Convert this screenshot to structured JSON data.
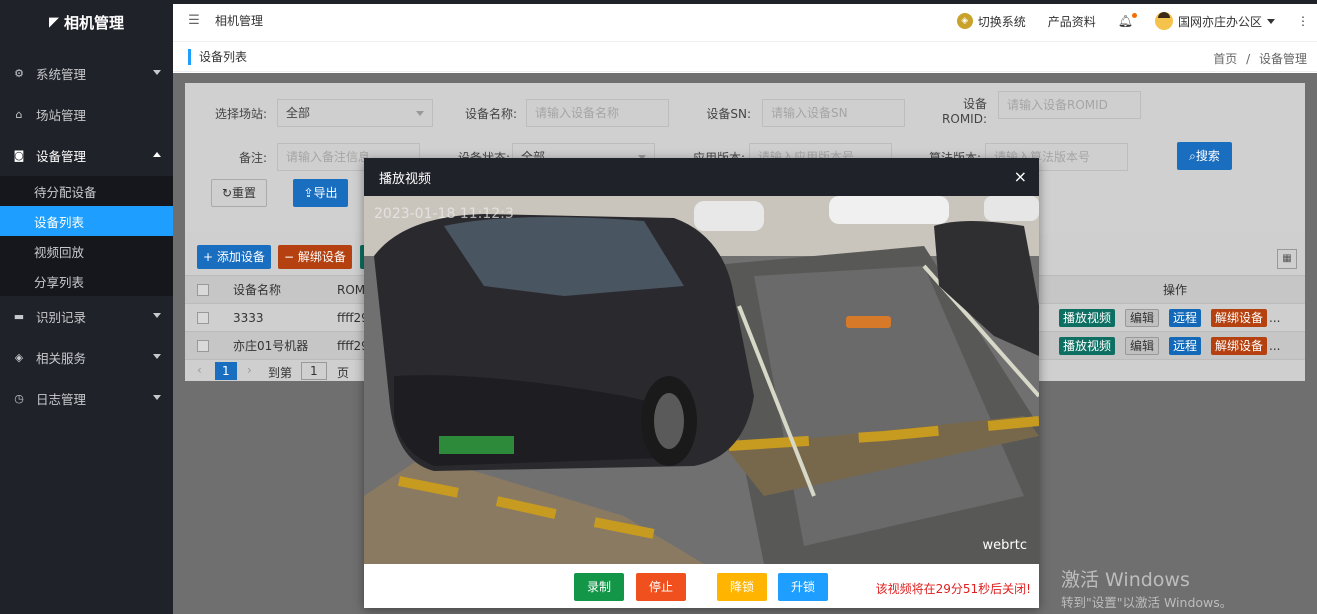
{
  "sidebar": {
    "logo": "相机管理",
    "menu": [
      {
        "label": "系统管理"
      },
      {
        "label": "场站管理"
      },
      {
        "label": "设备管理"
      },
      {
        "label": "识别记录"
      },
      {
        "label": "相关服务"
      },
      {
        "label": "日志管理"
      }
    ],
    "submenu": [
      "待分配设备",
      "设备列表",
      "视频回放",
      "分享列表"
    ]
  },
  "header": {
    "tab": "相机管理",
    "switch_system": "切换系统",
    "product_docs": "产品资料",
    "user": "国网亦庄办公区"
  },
  "page": {
    "title": "设备列表",
    "breadcrumb_home": "首页",
    "breadcrumb_sep": "/",
    "breadcrumb_current": "设备管理"
  },
  "filters": {
    "station_label": "选择场站:",
    "station_value": "全部",
    "name_label": "设备名称:",
    "name_placeholder": "请输入设备名称",
    "sn_label": "设备SN:",
    "sn_placeholder": "请输入设备SN",
    "romid_label_1": "设备",
    "romid_label_2": "ROMID:",
    "romid_placeholder": "请输入设备ROMID",
    "remark_label": "备注:",
    "remark_placeholder": "请输入备注信息",
    "status_label": "设备状态:",
    "status_value": "全部",
    "app_label": "应用版本:",
    "app_placeholder": "请输入应用版本号",
    "algo_label": "算法版本:",
    "algo_placeholder": "请输入算法版本号",
    "search": "搜索",
    "reset": "重置",
    "export": "导出"
  },
  "toolbar": {
    "add": "+ 添加设备",
    "unbind": "− 解绑设备"
  },
  "table": {
    "headers": [
      "设备名称",
      "ROM",
      "操作"
    ],
    "rows": [
      {
        "name": "3333",
        "rom": "ffff29"
      },
      {
        "name": "亦庄01号机器",
        "rom": "ffff29"
      }
    ],
    "actions": [
      "播放视频",
      "编辑",
      "远程",
      "解绑设备",
      "..."
    ]
  },
  "pager": {
    "current": "1",
    "goto": "到第",
    "page_input": "1",
    "page_unit": "页"
  },
  "modal": {
    "title": "播放视频",
    "close": "×",
    "video_label": "webrtc",
    "record": "录制",
    "stop": "停止",
    "lower_lock": "降锁",
    "raise_lock": "升锁",
    "notice": "该视频将在29分51秒后关闭!"
  },
  "watermark": {
    "line1": "激活 Windows",
    "line2": "转到\"设置\"以激活 Windows。"
  }
}
